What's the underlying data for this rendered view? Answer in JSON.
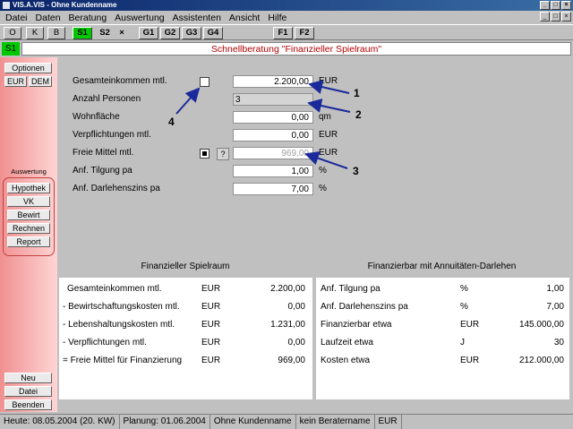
{
  "window": {
    "title": "VIS.A.VIS - Ohne Kundenname",
    "controls": [
      "_",
      "□",
      "×"
    ]
  },
  "menu": [
    "Datei",
    "Daten",
    "Beratung",
    "Auswertung",
    "Assistenten",
    "Ansicht",
    "Hilfe"
  ],
  "mdi_controls": [
    "_",
    "□",
    "×"
  ],
  "toolbar": [
    "O",
    "K",
    "B",
    "S1",
    "S2",
    "×",
    "G1",
    "G2",
    "G3",
    "G4",
    "F1",
    "F2"
  ],
  "header": {
    "badge": "S1",
    "title": "Schnellberatung \"Finanzieller Spielraum\""
  },
  "sidebar": {
    "options": "Optionen",
    "currency_eur": "EUR",
    "currency_dem": "DEM",
    "section_label": "Auswertung",
    "items": [
      "Hypothek",
      "VK",
      "Bewirt",
      "Rechnen",
      "Report"
    ],
    "bottom": [
      "Neu",
      "Datei",
      "Beenden"
    ]
  },
  "form": {
    "rows": [
      {
        "label": "Gesamteinkommen mtl.",
        "value": "2.200,00",
        "unit": "EUR"
      },
      {
        "label": "Anzahl Personen",
        "value": "3",
        "unit": ""
      },
      {
        "label": "Wohnfläche",
        "value": "0,00",
        "unit": "qm"
      },
      {
        "label": "Verpflichtungen mtl.",
        "value": "0,00",
        "unit": "EUR"
      },
      {
        "label": "Freie Mittel mtl.",
        "value": "969,00",
        "unit": "EUR"
      },
      {
        "label": "Anf. Tilgung pa",
        "value": "1,00",
        "unit": "%"
      },
      {
        "label": "Anf. Darlehenszins pa",
        "value": "7,00",
        "unit": "%"
      }
    ],
    "question_btn": "?",
    "callouts": [
      "1",
      "2",
      "3",
      "4"
    ]
  },
  "panel_left": {
    "title": "Finanzieller Spielraum",
    "rows": [
      {
        "label": "Gesamteinkommen mtl.",
        "unit": "EUR",
        "value": "2.200,00"
      },
      {
        "label": "- Bewirtschaftungskosten mtl.",
        "unit": "EUR",
        "value": "0,00"
      },
      {
        "label": "- Lebenshaltungskosten mtl.",
        "unit": "EUR",
        "value": "1.231,00"
      },
      {
        "label": "- Verpflichtungen mtl.",
        "unit": "EUR",
        "value": "0,00"
      },
      {
        "label": "= Freie Mittel für Finanzierung",
        "unit": "EUR",
        "value": "969,00"
      }
    ]
  },
  "panel_right": {
    "title": "Finanzierbar mit Annuitäten-Darlehen",
    "rows": [
      {
        "label": "Anf. Tilgung pa",
        "unit": "%",
        "value": "1,00"
      },
      {
        "label": "Anf. Darlehenszins pa",
        "unit": "%",
        "value": "7,00"
      },
      {
        "label": "Finanzierbar etwa",
        "unit": "EUR",
        "value": "145.000,00"
      },
      {
        "label": "Laufzeit etwa",
        "unit": "J",
        "value": "30"
      },
      {
        "label": "Kosten etwa",
        "unit": "EUR",
        "value": "212.000,00"
      }
    ]
  },
  "status": [
    "Heute: 08.05.2004 (20. KW)",
    "Planung: 01.06.2004",
    "Ohne Kundenname",
    "kein Beratername",
    "EUR"
  ]
}
